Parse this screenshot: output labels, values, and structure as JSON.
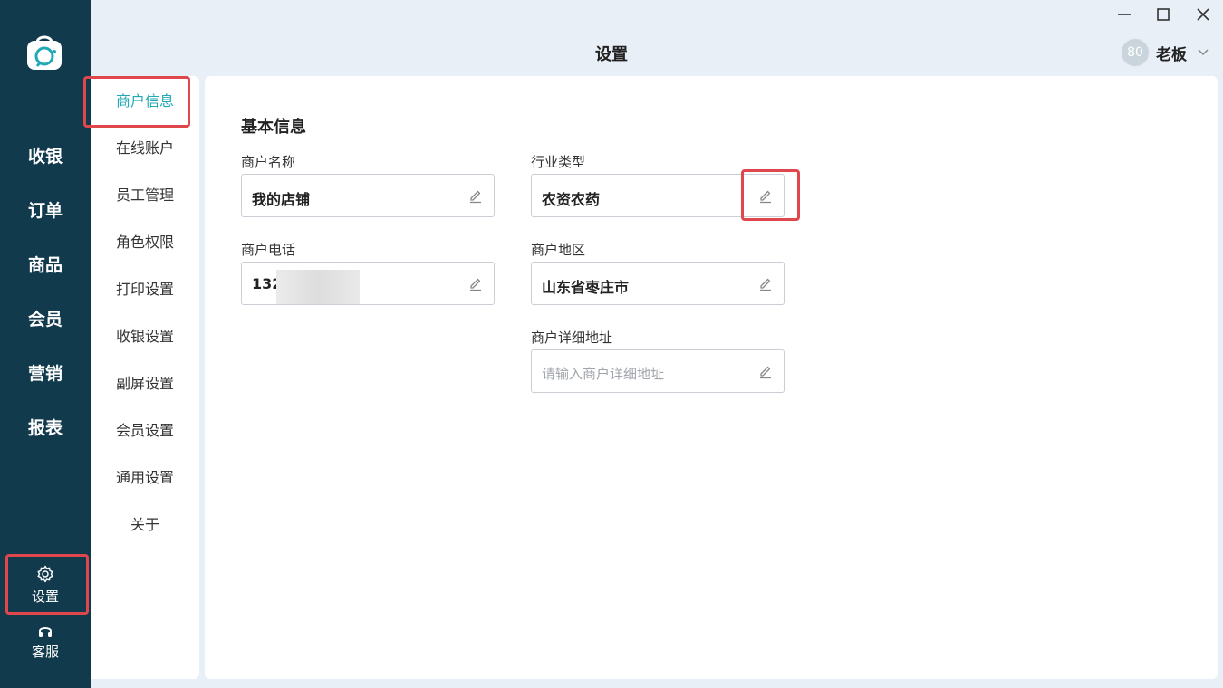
{
  "app": {
    "page_title": "设置",
    "user": {
      "avatar_text": "80",
      "name": "老板"
    }
  },
  "leftnav": {
    "items": [
      {
        "label": "收银"
      },
      {
        "label": "订单"
      },
      {
        "label": "商品"
      },
      {
        "label": "会员"
      },
      {
        "label": "营销"
      },
      {
        "label": "报表"
      }
    ],
    "settings_label": "设置",
    "service_label": "客服"
  },
  "submenu": {
    "items": [
      {
        "label": "商户信息"
      },
      {
        "label": "在线账户"
      },
      {
        "label": "员工管理"
      },
      {
        "label": "角色权限"
      },
      {
        "label": "打印设置"
      },
      {
        "label": "收银设置"
      },
      {
        "label": "副屏设置"
      },
      {
        "label": "会员设置"
      },
      {
        "label": "通用设置"
      },
      {
        "label": "关于"
      }
    ],
    "active_index": 0
  },
  "basic_info": {
    "title": "基本信息",
    "merchant_name": {
      "label": "商户名称",
      "value": "我的店铺"
    },
    "industry": {
      "label": "行业类型",
      "value": "农资农药"
    },
    "phone": {
      "label": "商户电话",
      "value": "132"
    },
    "region": {
      "label": "商户地区",
      "value": "山东省枣庄市"
    },
    "address": {
      "label": "商户详细地址",
      "placeholder": "请输入商户详细地址"
    }
  },
  "colors": {
    "nav_bg": "#123a4d",
    "accent": "#23a9b5",
    "highlight": "#e0474c",
    "bg": "#e8eff6"
  }
}
